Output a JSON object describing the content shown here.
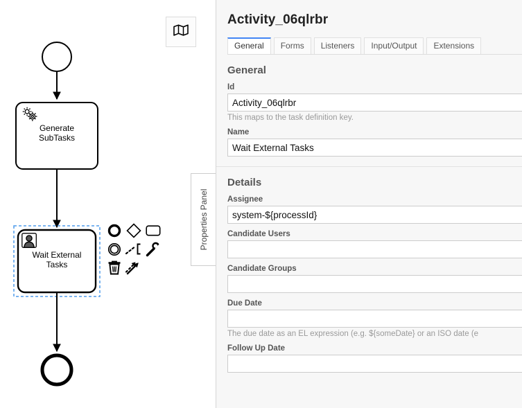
{
  "canvas": {
    "minimap_toggle": {
      "icon": "map-icon",
      "title": "Toggle minimap"
    },
    "elements": [
      {
        "type": "start-event",
        "label": ""
      },
      {
        "type": "service-task",
        "label": "Generate\nSubTasks",
        "icon": "gear-icon"
      },
      {
        "type": "user-task",
        "label": "Wait External\nTasks",
        "icon": "user-icon",
        "selected": true
      },
      {
        "type": "end-event",
        "label": ""
      }
    ],
    "selection_color": "#4f9ceb",
    "stroke_color": "#000000",
    "context_pad": [
      {
        "name": "append-end-event",
        "icon": "circle-thick-icon"
      },
      {
        "name": "append-gateway",
        "icon": "diamond-icon"
      },
      {
        "name": "append-task",
        "icon": "rounded-rect-icon"
      },
      {
        "name": "append-intermediate-event",
        "icon": "double-circle-icon"
      },
      {
        "name": "append-text-annotation",
        "icon": "text-annotation-icon"
      },
      {
        "name": "change-element-type",
        "icon": "wrench-icon"
      },
      {
        "name": "delete-element",
        "icon": "trash-icon"
      },
      {
        "name": "connect",
        "icon": "connect-arrows-icon"
      }
    ]
  },
  "properties_panel_tab": {
    "label": "Properties Panel"
  },
  "panel": {
    "title": "Activity_06qlrbr",
    "accent_color": "#4285f4",
    "tabs": [
      {
        "label": "General",
        "active": true
      },
      {
        "label": "Forms",
        "active": false
      },
      {
        "label": "Listeners",
        "active": false
      },
      {
        "label": "Input/Output",
        "active": false
      },
      {
        "label": "Extensions",
        "active": false
      }
    ],
    "groups": [
      {
        "title": "General",
        "fields": [
          {
            "label": "Id",
            "value": "Activity_06qlrbr",
            "placeholder": "",
            "hint": "This maps to the task definition key."
          },
          {
            "label": "Name",
            "value": "Wait External Tasks",
            "placeholder": "",
            "hint": ""
          }
        ]
      },
      {
        "title": "Details",
        "fields": [
          {
            "label": "Assignee",
            "value": "system-${processId}",
            "placeholder": "",
            "hint": ""
          },
          {
            "label": "Candidate Users",
            "value": "",
            "placeholder": "",
            "hint": ""
          },
          {
            "label": "Candidate Groups",
            "value": "",
            "placeholder": "",
            "hint": ""
          },
          {
            "label": "Due Date",
            "value": "",
            "placeholder": "",
            "hint": "The due date as an EL expression (e.g. ${someDate} or an ISO date (e"
          },
          {
            "label": "Follow Up Date",
            "value": "",
            "placeholder": "",
            "hint": ""
          }
        ]
      }
    ]
  }
}
